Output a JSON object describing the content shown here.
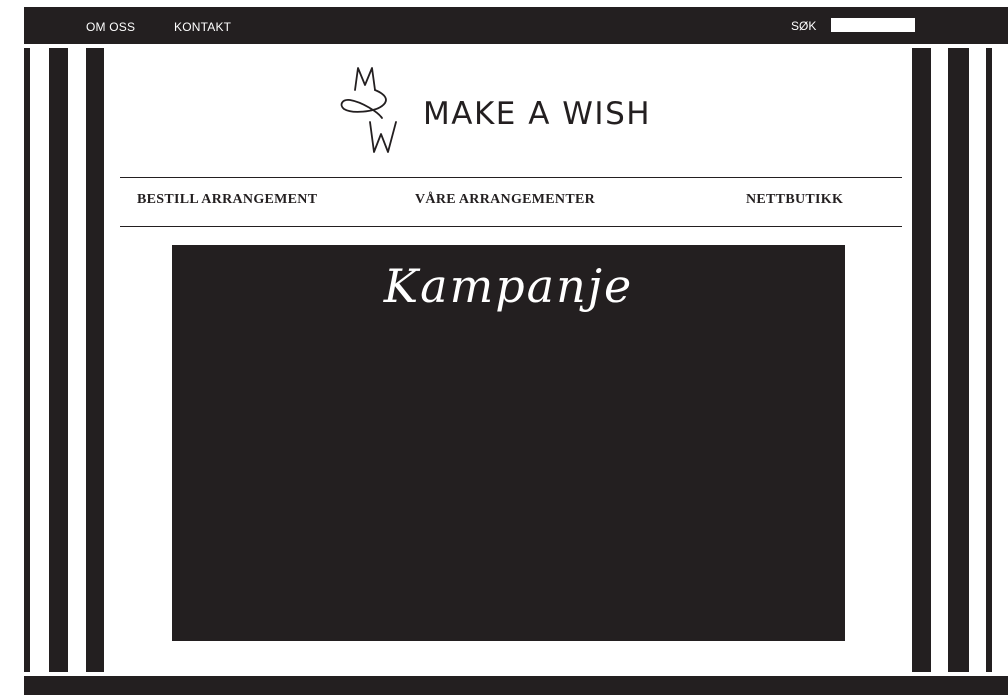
{
  "top_nav": {
    "about": "OM OSS",
    "contact": "KONTAKT"
  },
  "search": {
    "label": "SØK",
    "value": ""
  },
  "logo": {
    "text": "MAKE A WISH",
    "monogram": "MW"
  },
  "main_nav": {
    "items": [
      "BESTILL ARRANGEMENT",
      "VÅRE ARRANGEMENTER",
      "NETTBUTIKK"
    ]
  },
  "banner": {
    "title": "Kampanje"
  },
  "colors": {
    "dark": "#231f20",
    "light": "#ffffff"
  }
}
